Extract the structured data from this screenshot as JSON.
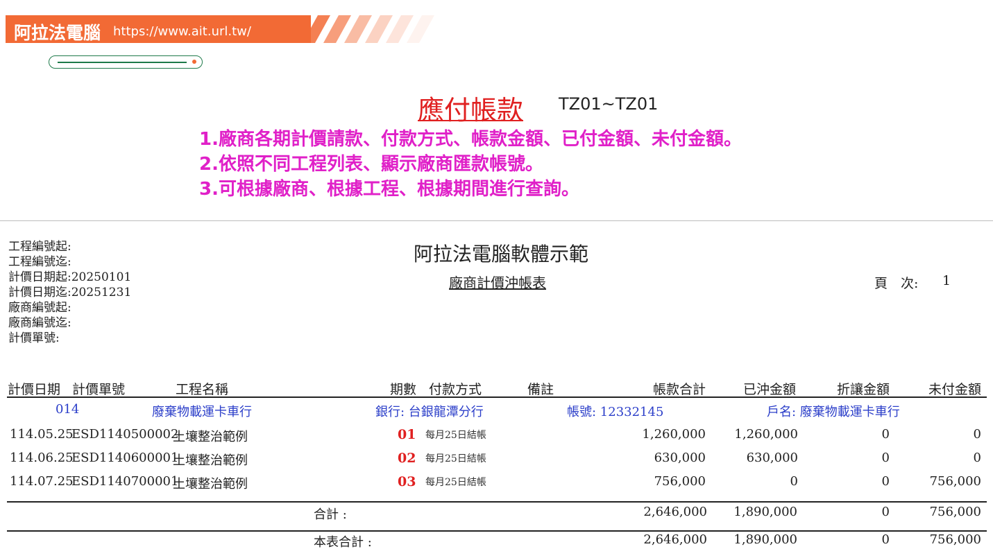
{
  "banner": {
    "brand": "阿拉法電腦",
    "url": "https://www.ait.url.tw/"
  },
  "intro": {
    "title": "應付帳款",
    "code_range": "TZ01~TZ01",
    "features": [
      "1.廠商各期計價請款、付款方式、帳款金額、已付金額、未付金額。",
      "2.依照不同工程列表、顯示廠商匯款帳號。",
      "3.可根據廠商、根據工程、根據期間進行查詢。"
    ]
  },
  "report": {
    "company": "阿拉法電腦軟體示範",
    "name": "廠商計價沖帳表",
    "page_label": "頁　次:",
    "page_number": "1",
    "criteria": [
      "工程編號起:",
      "工程編號迄:",
      "計價日期起:20250101",
      "計價日期迄:20251231",
      "廠商編號起:",
      "廠商編號迄:",
      "計價單號:"
    ]
  },
  "table": {
    "headers": {
      "date": "計價日期",
      "doc_no": "計價單號",
      "project": "工程名稱",
      "period": "期數",
      "payment": "付款方式",
      "note": "備註",
      "total": "帳款合計",
      "settled": "已沖金額",
      "discount": "折讓金額",
      "unpaid": "未付金額"
    },
    "vendor": {
      "code": "014",
      "name": "廢棄物載運卡車行",
      "bank": "銀行: 台銀龍潭分行",
      "account": "帳號: 12332145",
      "holder": "戶名: 廢棄物載運卡車行"
    },
    "rows": [
      {
        "date": "114.05.25",
        "doc_no": "ESD1140500002",
        "project": "土壤整治範例",
        "period": "01",
        "payment": "每月25日結帳",
        "total": "1,260,000",
        "settled": "1,260,000",
        "discount": "0",
        "unpaid": "0"
      },
      {
        "date": "114.06.25",
        "doc_no": "ESD1140600001",
        "project": "土壤整治範例",
        "period": "02",
        "payment": "每月25日結帳",
        "total": "630,000",
        "settled": "630,000",
        "discount": "0",
        "unpaid": "0"
      },
      {
        "date": "114.07.25",
        "doc_no": "ESD1140700001",
        "project": "土壤整治範例",
        "period": "03",
        "payment": "每月25日結帳",
        "total": "756,000",
        "settled": "0",
        "discount": "0",
        "unpaid": "756,000"
      }
    ],
    "subtotal": {
      "label": "合計 :",
      "total": "2,646,000",
      "settled": "1,890,000",
      "discount": "0",
      "unpaid": "756,000"
    },
    "grand_total": {
      "label": "本表合計 :",
      "total": "2,646,000",
      "settled": "1,890,000",
      "discount": "0",
      "unpaid": "756,000"
    }
  }
}
